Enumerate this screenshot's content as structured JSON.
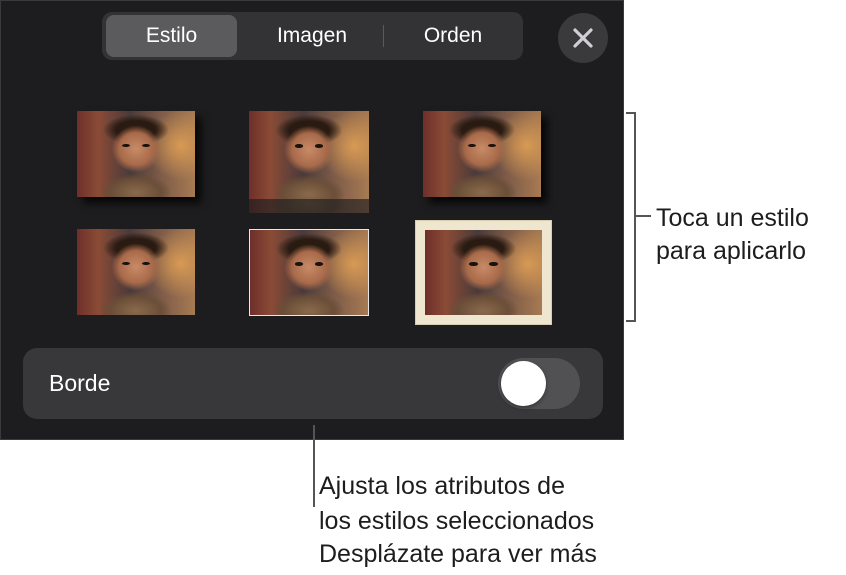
{
  "tabs": [
    {
      "label": "Estilo",
      "active": true
    },
    {
      "label": "Imagen",
      "active": false
    },
    {
      "label": "Orden",
      "active": false
    }
  ],
  "close_icon": "close-icon",
  "styles": [
    {
      "name": "style-1",
      "treatment": "shadow"
    },
    {
      "name": "style-2",
      "treatment": "reflection"
    },
    {
      "name": "style-3",
      "treatment": "shadow"
    },
    {
      "name": "style-4",
      "treatment": "plain"
    },
    {
      "name": "style-5",
      "treatment": "thin-border"
    },
    {
      "name": "style-6",
      "treatment": "cream-frame"
    }
  ],
  "border_row": {
    "label": "Borde",
    "toggle_on": false
  },
  "callouts": {
    "styles_line1": "Toca un estilo",
    "styles_line2": "para aplicarlo",
    "border_line1": "Ajusta los atributos de",
    "border_line2": "los estilos seleccionados",
    "border_line3": "Desplázate para ver más"
  },
  "colors": {
    "panel_bg": "#1d1d1f",
    "segment_bg": "#333336",
    "segment_active": "#5b5b5e",
    "row_bg": "#38383a",
    "toggle_off": "#515154"
  }
}
